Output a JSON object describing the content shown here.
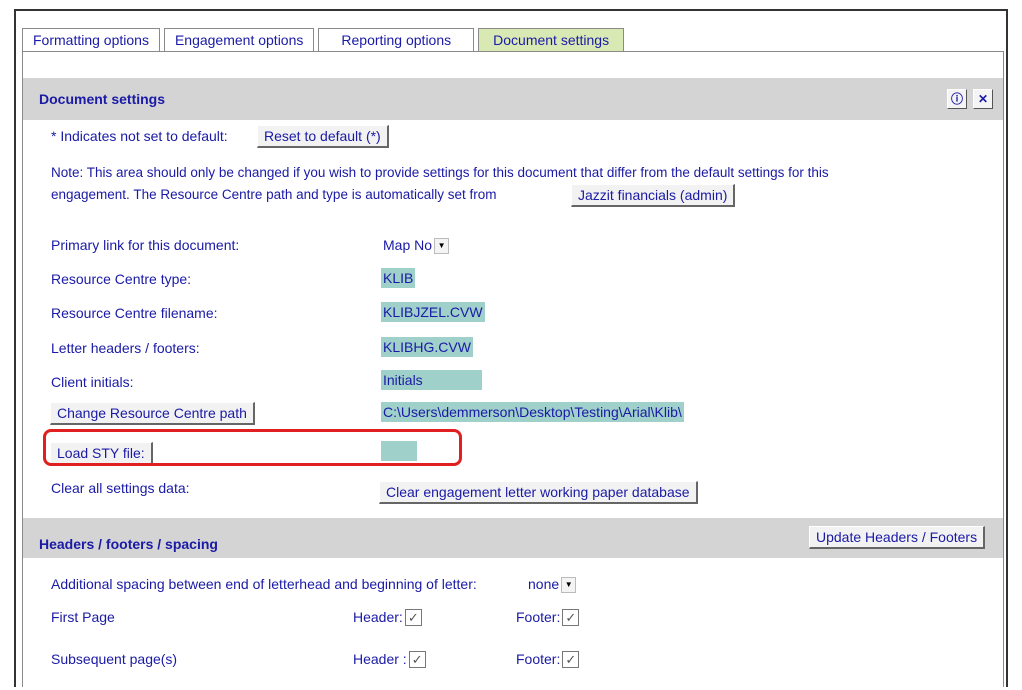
{
  "tabs": [
    {
      "label": "Formatting options"
    },
    {
      "label": "Engagement options"
    },
    {
      "label": "Reporting options"
    },
    {
      "label": "Document settings"
    }
  ],
  "document_settings": {
    "title": "Document settings",
    "default_note": "* Indicates not set to default:",
    "reset_button": "Reset to default (*)",
    "note_line1": "Note: This area should only be changed if you wish to provide settings for this document that differ from the default settings for this",
    "note_line2": "engagement. The Resource Centre path and type is automatically set from",
    "source_button": "Jazzit financials (admin)",
    "rows": {
      "primary_link": {
        "label": "Primary link for this document:",
        "value": "Map No"
      },
      "rc_type": {
        "label": "Resource Centre type:",
        "value": "KLIB"
      },
      "rc_filename": {
        "label": "Resource Centre filename:",
        "value": "KLIBJZEL.CVW"
      },
      "headers_footers": {
        "label": "Letter headers / footers:",
        "value": "KLIBHG.CVW"
      },
      "client_initials": {
        "label": "Client initials:",
        "value": "Initials"
      },
      "rc_path": {
        "button": "Change Resource Centre path",
        "value": "C:\\Users\\demmerson\\Desktop\\Testing\\Arial\\Klib\\"
      },
      "load_sty": {
        "button": "Load STY file:",
        "value": ""
      },
      "clear": {
        "label": "Clear all settings data:",
        "button": "Clear engagement letter working paper database"
      }
    }
  },
  "headers_section": {
    "title": "Headers / footers / spacing",
    "update_button": "Update Headers / Footers",
    "spacing_label": "Additional spacing between end of letterhead and beginning of letter:",
    "spacing_value": "none",
    "first_page": {
      "label": "First Page",
      "header_label": "Header:",
      "footer_label": "Footer:",
      "header_checked": true,
      "footer_checked": true
    },
    "subsequent": {
      "label": "Subsequent page(s)",
      "header_label": "Header :",
      "footer_label": "Footer:",
      "header_checked": true,
      "footer_checked": true
    }
  },
  "icons": {
    "info": "info-icon",
    "close": "close-icon",
    "check": "checkmark-icon",
    "dropdown": "chevron-down-icon"
  },
  "colors": {
    "text": "#1a1aa6",
    "active_tab": "#d9e9b4",
    "value_fill": "#9fd0c9",
    "section_header": "#d4d4d4",
    "highlight": "#e02020"
  }
}
